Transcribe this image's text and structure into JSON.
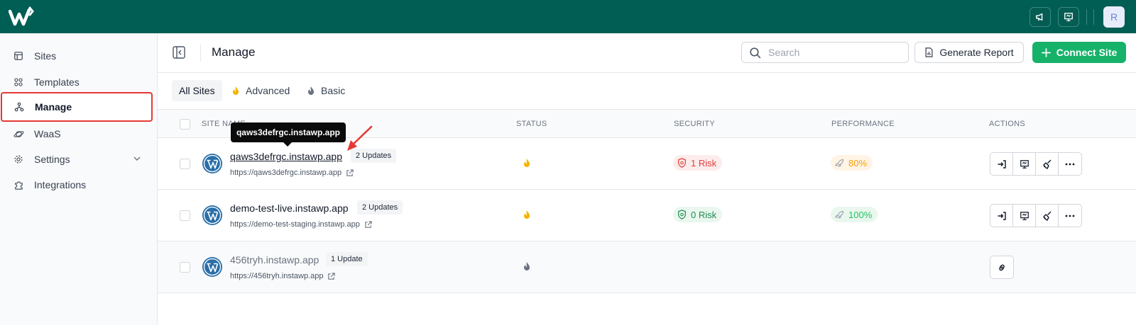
{
  "topbar": {
    "avatar_initial": "R",
    "icons": [
      "megaphone-icon",
      "presentation-icon"
    ]
  },
  "sidebar": {
    "items": [
      {
        "label": "Sites",
        "icon": "layout-icon"
      },
      {
        "label": "Templates",
        "icon": "grid-icon"
      },
      {
        "label": "Manage",
        "icon": "network-icon",
        "active": true
      },
      {
        "label": "WaaS",
        "icon": "planet-icon"
      },
      {
        "label": "Settings",
        "icon": "gear-icon",
        "expandable": true
      },
      {
        "label": "Integrations",
        "icon": "puzzle-icon"
      }
    ]
  },
  "header": {
    "title": "Manage",
    "search_placeholder": "Search",
    "generate_report": "Generate Report",
    "connect_site": "Connect Site"
  },
  "filters": [
    {
      "label": "All Sites",
      "active": true
    },
    {
      "label": "Advanced",
      "icon": "flame-yellow-icon"
    },
    {
      "label": "Basic",
      "icon": "flame-gray-icon"
    }
  ],
  "table": {
    "headers": [
      "SITE NAME",
      "STATUS",
      "SECURITY",
      "PERFORMANCE",
      "ACTIONS"
    ],
    "rows": [
      {
        "name": "qaws3defrgc.instawp.app",
        "updates": "2 Updates",
        "url": "https://qaws3defrgc.instawp.app",
        "security": "1 Risk",
        "performance": "80%"
      },
      {
        "name": "demo-test-live.instawp.app",
        "updates": "2 Updates",
        "url": "https://demo-test-staging.instawp.app",
        "security": "0 Risk",
        "performance": "100%"
      },
      {
        "name": "456tryh.instawp.app",
        "updates": "1 Update",
        "url": "https://456tryh.instawp.app"
      }
    ]
  },
  "tooltip": {
    "text": "qaws3defrgc.instawp.app"
  },
  "colors": {
    "topbar": "#005e54",
    "accent_green": "#16b26a",
    "risk_red": "#e03c3c",
    "annotation_red": "#e53935"
  }
}
